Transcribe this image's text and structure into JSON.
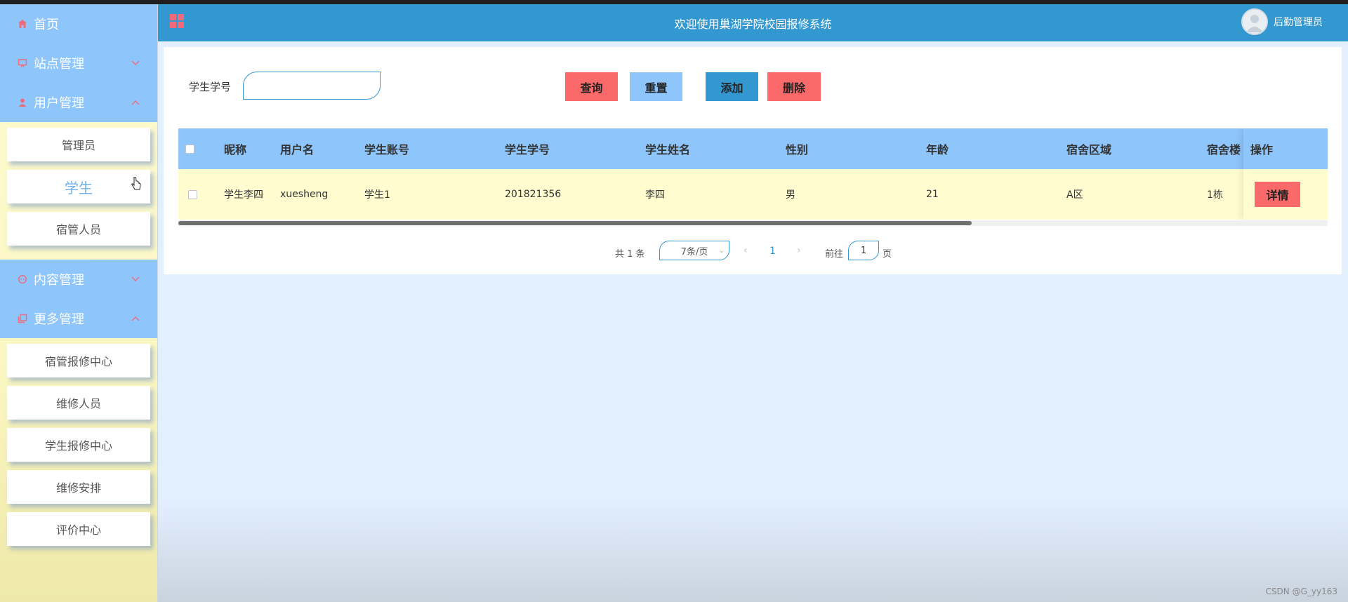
{
  "sidebar": {
    "home": "首页",
    "site_mgmt": "站点管理",
    "user_mgmt": "用户管理",
    "user_items": [
      "管理员",
      "学生",
      "宿管人员"
    ],
    "content_mgmt": "内容管理",
    "more_mgmt": "更多管理",
    "more_items": [
      "宿管报修中心",
      "维修人员",
      "学生报修中心",
      "维修安排",
      "评价中心"
    ]
  },
  "header": {
    "title": "欢迎使用巢湖学院校园报修系统",
    "user_name": "后勤管理员"
  },
  "search": {
    "label": "学生学号",
    "value": ""
  },
  "buttons": {
    "query": "查询",
    "reset": "重置",
    "add": "添加",
    "delete": "删除",
    "detail": "详情"
  },
  "table": {
    "columns": [
      "昵称",
      "用户名",
      "学生账号",
      "学生学号",
      "学生姓名",
      "性别",
      "年龄",
      "宿舍区域",
      "宿舍楼"
    ],
    "op_column": "操作",
    "rows": [
      [
        "学生李四",
        "xuesheng",
        "学生1",
        "201821356",
        "李四",
        "男",
        "21",
        "A区",
        "1栋"
      ]
    ]
  },
  "pagination": {
    "total": "共 1 条",
    "page_size": "7条/页",
    "current_page": "1",
    "goto_label": "前往",
    "goto_value": "1",
    "page_word": "页"
  },
  "watermark": "CSDN @G_yy163",
  "colors": {
    "header_bg": "#3397d0",
    "menu_bg": "#8ec5fb",
    "danger": "#fb6a6a",
    "row_bg": "#fffdd0"
  }
}
